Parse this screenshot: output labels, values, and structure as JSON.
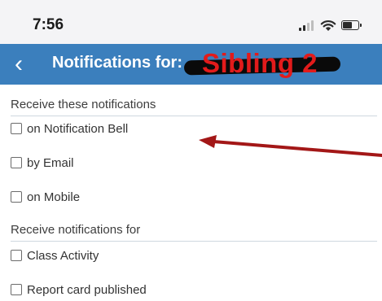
{
  "status_bar": {
    "time": "7:56"
  },
  "nav": {
    "back_glyph": "‹",
    "title": "Notifications for:",
    "redacted_name": "Sibling 2"
  },
  "sections": [
    {
      "header": "Receive these notifications",
      "options": [
        {
          "label": "on Notification Bell",
          "checked": false
        },
        {
          "label": "by Email",
          "checked": false
        },
        {
          "label": "on Mobile",
          "checked": false
        }
      ]
    },
    {
      "header": "Receive notifications for",
      "options": [
        {
          "label": "Class Activity",
          "checked": false
        },
        {
          "label": "Report card published",
          "checked": false
        }
      ]
    }
  ],
  "colors": {
    "nav_background": "#3b7fbd",
    "annotation_arrow": "#a31717",
    "redaction_text": "#e21b1b"
  }
}
